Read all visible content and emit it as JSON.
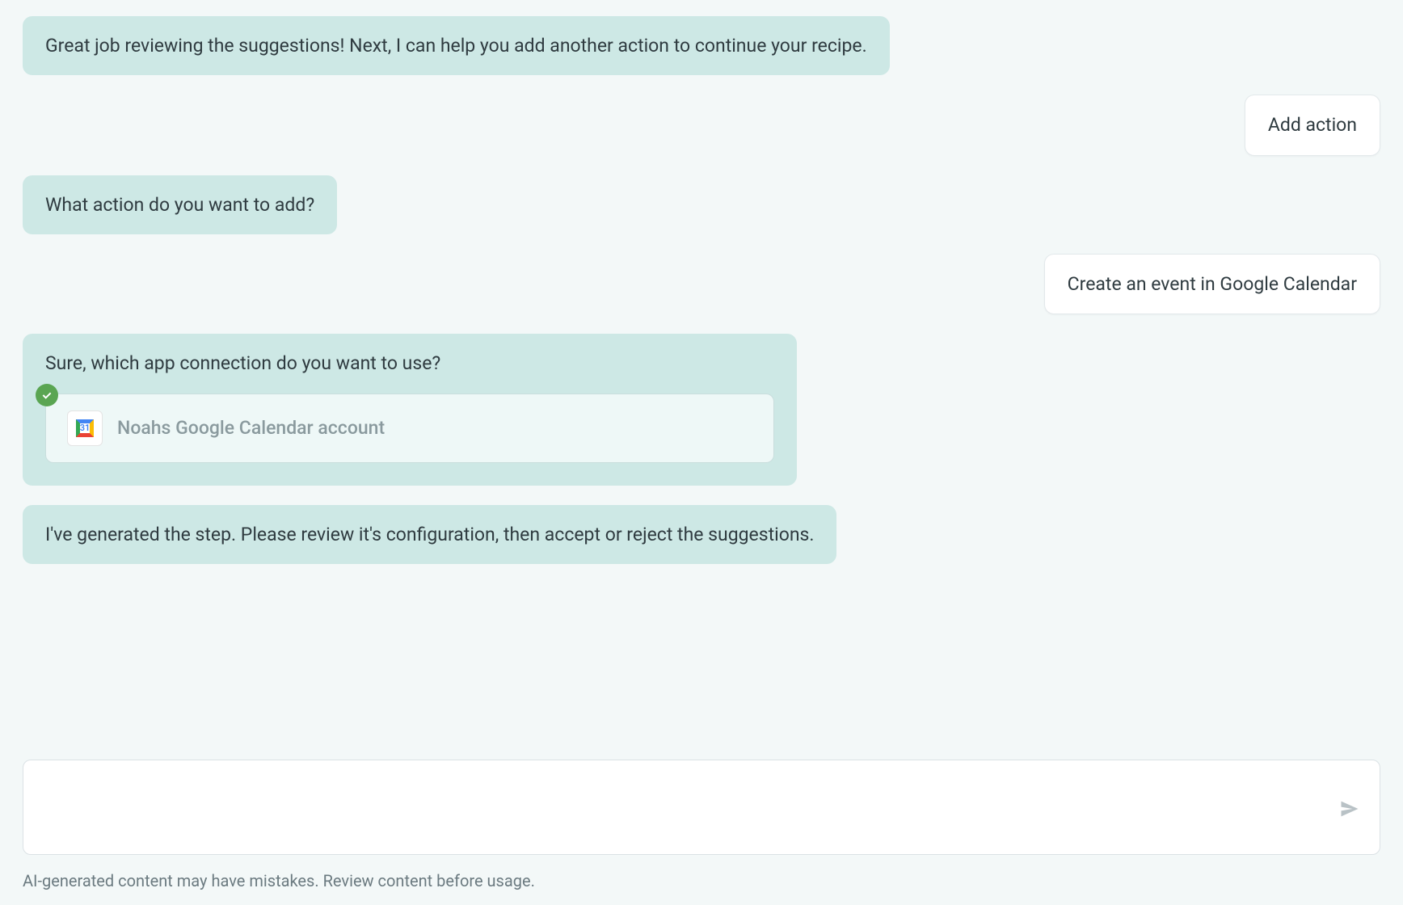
{
  "messages": {
    "m0": "Great job reviewing the suggestions! Next, I can help you add another action to continue your recipe.",
    "m1": "Add action",
    "m2": "What action do you want to add?",
    "m3": "Create an event in Google Calendar",
    "m4_prompt": "Sure, which app connection do you want to use?",
    "m4_connection": "Noahs Google Calendar account",
    "m5": "I've generated the step. Please review it's configuration, then accept or reject the suggestions."
  },
  "gcal_day": "31",
  "input": {
    "value": "",
    "placeholder": ""
  },
  "disclaimer": "AI-generated content may have mistakes. Review content before usage."
}
